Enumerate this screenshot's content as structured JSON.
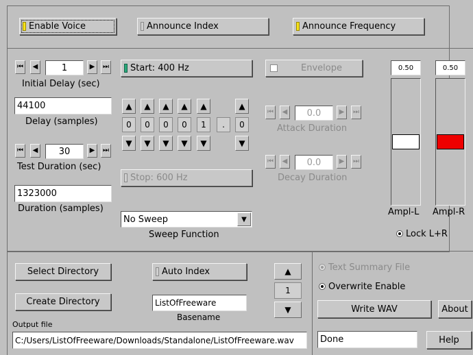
{
  "top": {
    "enable_voice": "Enable Voice",
    "announce_index": "Announce Index",
    "announce_frequency": "Announce Frequency"
  },
  "left": {
    "initial_delay_value": "1",
    "initial_delay_label": "Initial Delay (sec)",
    "delay_samples_value": "44100",
    "delay_samples_label": "Delay (samples)",
    "test_duration_value": "30",
    "test_duration_label": "Test Duration (sec)",
    "duration_samples_value": "1323000",
    "duration_samples_label": "Duration (samples)"
  },
  "middle": {
    "start_label": "Start: 400 Hz",
    "digits": [
      "0",
      "0",
      "0",
      "0",
      "1"
    ],
    "decimal_point": ".",
    "decimal_digit": "0",
    "stop_label": "Stop: 600 Hz",
    "sweep_value": "No Sweep",
    "sweep_label": "Sweep Function"
  },
  "envelope": {
    "button": "Envelope",
    "attack_value": "0.0",
    "attack_label": "Attack Duration",
    "decay_value": "0.0",
    "decay_label": "Decay Duration"
  },
  "amplitude": {
    "left_value": "0.50",
    "right_value": "0.50",
    "left_label": "Ampl-L",
    "right_label": "Ampl-R",
    "lock_label": "Lock L+R",
    "left_level": 0.5,
    "right_level": 0.5,
    "left_color": "#ffffff",
    "right_color": "#ee0000"
  },
  "bottom": {
    "select_directory": "Select Directory",
    "create_directory": "Create Directory",
    "auto_index": "Auto Index",
    "basename_value": "ListOfFreeware",
    "basename_label": "Basename",
    "index_value": "1",
    "output_label": "Output file",
    "output_path": "C:/Users/ListOfFreeware/Downloads/Standalone/ListOfFreeware.wav"
  },
  "right_panel": {
    "text_summary": "Text Summary File",
    "overwrite": "Overwrite Enable",
    "write_wav": "Write WAV",
    "about": "About",
    "status": "Done",
    "help": "Help"
  },
  "icons": {
    "first": "⏮",
    "prev": "◀",
    "next": "▶",
    "last": "⏭",
    "up": "▲",
    "down": "▼"
  }
}
